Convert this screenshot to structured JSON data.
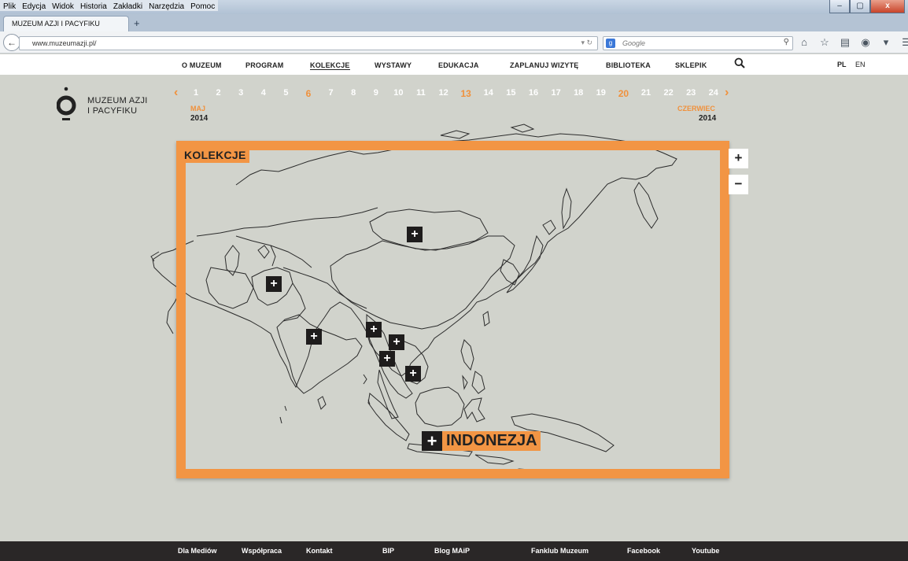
{
  "browser": {
    "menu": [
      "Plik",
      "Edycja",
      "Widok",
      "Historia",
      "Zakładki",
      "Narzędzia",
      "Pomoc"
    ],
    "tab_title": "MUZEUM AZJI I PACYFIKU",
    "url": "www.muzeumazji.pl/",
    "search_placeholder": "Google",
    "new_tab": "+",
    "window_controls": [
      "–",
      "▢",
      "x"
    ]
  },
  "site_nav": {
    "items": [
      "O MUZEUM",
      "PROGRAM",
      "KOLEKCJE",
      "WYSTAWY",
      "EDUKACJA",
      "ZAPLANUJ WIZYTĘ",
      "BIBLIOTEKA",
      "SKLEPIK"
    ],
    "active": "KOLEKCJE",
    "languages": [
      "PL",
      "EN"
    ],
    "active_language": "PL"
  },
  "logo": {
    "line1": "MUZEUM AZJI",
    "line2": "I PACYFIKU"
  },
  "calendar": {
    "days": [
      "1",
      "2",
      "3",
      "4",
      "5",
      "6",
      "7",
      "8",
      "9",
      "10",
      "11",
      "12",
      "13",
      "14",
      "15",
      "16",
      "17",
      "18",
      "19",
      "20",
      "21",
      "22",
      "23",
      "24"
    ],
    "highlighted_days": [
      "6",
      "13",
      "20"
    ],
    "start_month": "MAJ",
    "start_year": "2014",
    "end_month": "CZERWIEC",
    "end_year": "2014",
    "prev": "‹",
    "next": "›"
  },
  "map": {
    "section_label": "KOLEKCJE",
    "marker_symbol": "+",
    "featured_region": "INDONEZJA",
    "zoom_in": "+",
    "zoom_out": "−",
    "frame_color": "#f29544"
  },
  "footer": {
    "items": [
      "Dla Mediów",
      "Współpraca",
      "Kontakt",
      "BIP",
      "Blog MAiP",
      "Fanklub Muzeum",
      "Facebook",
      "Youtube"
    ]
  }
}
